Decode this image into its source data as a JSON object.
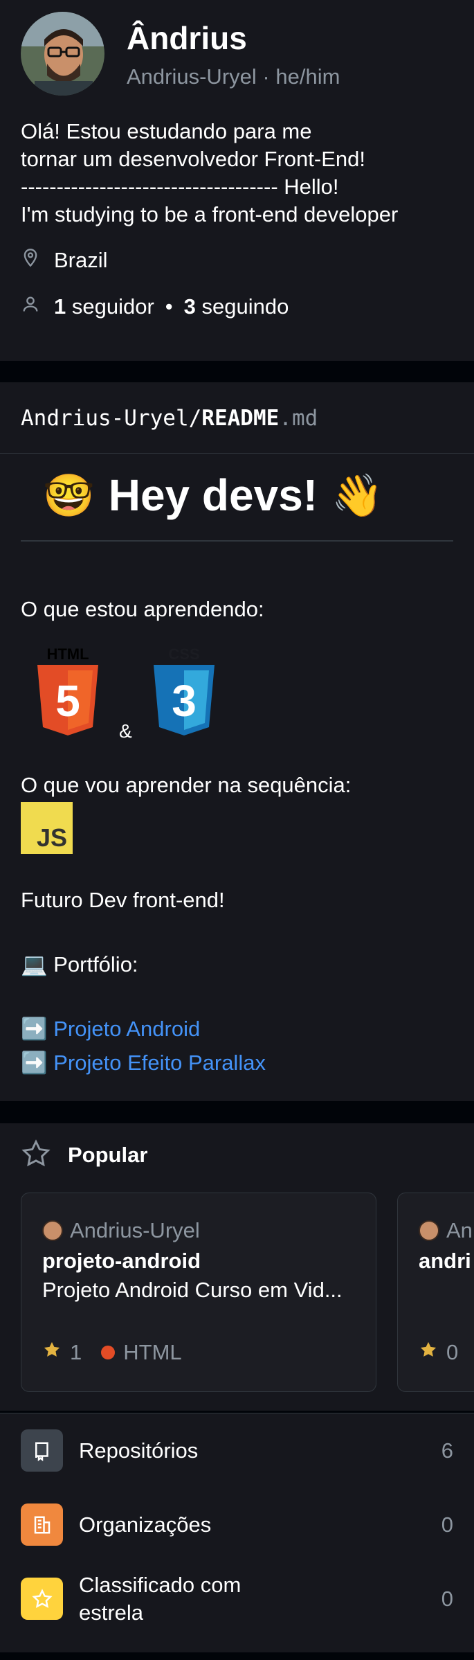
{
  "profile": {
    "display_name": "Ândrius",
    "username": "Andrius-Uryel",
    "pronouns_sep": "·",
    "pronouns": "he/him",
    "bio": "Olá! Estou estudando para me\ntornar um desenvolvedor Front-End!\n------------------------------------ Hello!\nI'm studying to be a front-end developer",
    "location": "Brazil",
    "followers_count": "1",
    "followers_label": "seguidor",
    "following_count": "3",
    "following_label": "seguindo",
    "bullet": "•"
  },
  "readme": {
    "path_owner": "Andrius-Uryel/",
    "path_file": "README",
    "path_ext": ".md",
    "heading": "Hey devs!",
    "heading_emoji_left": "🤓",
    "heading_emoji_right": "👋",
    "learning_label": "O que estou aprendendo:",
    "html_badge": "HTML",
    "html_number": "5",
    "css_badge": "CSS",
    "css_number": "3",
    "ampersand": "&",
    "next_label": "O que vou aprender na sequência:",
    "js_badge": "JS",
    "future_text": "Futuro Dev front-end!",
    "portfolio_label": "💻 Portfólio:",
    "arrow": "➡️",
    "links": [
      {
        "label": "Projeto Android"
      },
      {
        "label": "Projeto Efeito Parallax"
      }
    ]
  },
  "popular": {
    "title": "Popular",
    "cards": [
      {
        "owner": "Andrius-Uryel",
        "repo": "projeto-android",
        "description": "Projeto Android Curso em Vid...",
        "stars": "1",
        "language": "HTML"
      },
      {
        "owner": "An",
        "repo": "andri",
        "description": "",
        "stars": "0",
        "language": ""
      }
    ]
  },
  "lists": [
    {
      "label": "Repositórios",
      "count": "6",
      "icon": "repo-icon",
      "color": "#3d444d"
    },
    {
      "label": "Organizações",
      "count": "0",
      "icon": "organization-icon",
      "color": "#f0883e"
    },
    {
      "label": "Classificado com estrela",
      "count": "0",
      "icon": "star-icon",
      "color": "#ffd33d"
    }
  ],
  "colors": {
    "background": "#16171d",
    "link": "#4493f8",
    "muted": "#8d96a0",
    "star": "#e3b341",
    "html_lang": "#e34c26"
  }
}
